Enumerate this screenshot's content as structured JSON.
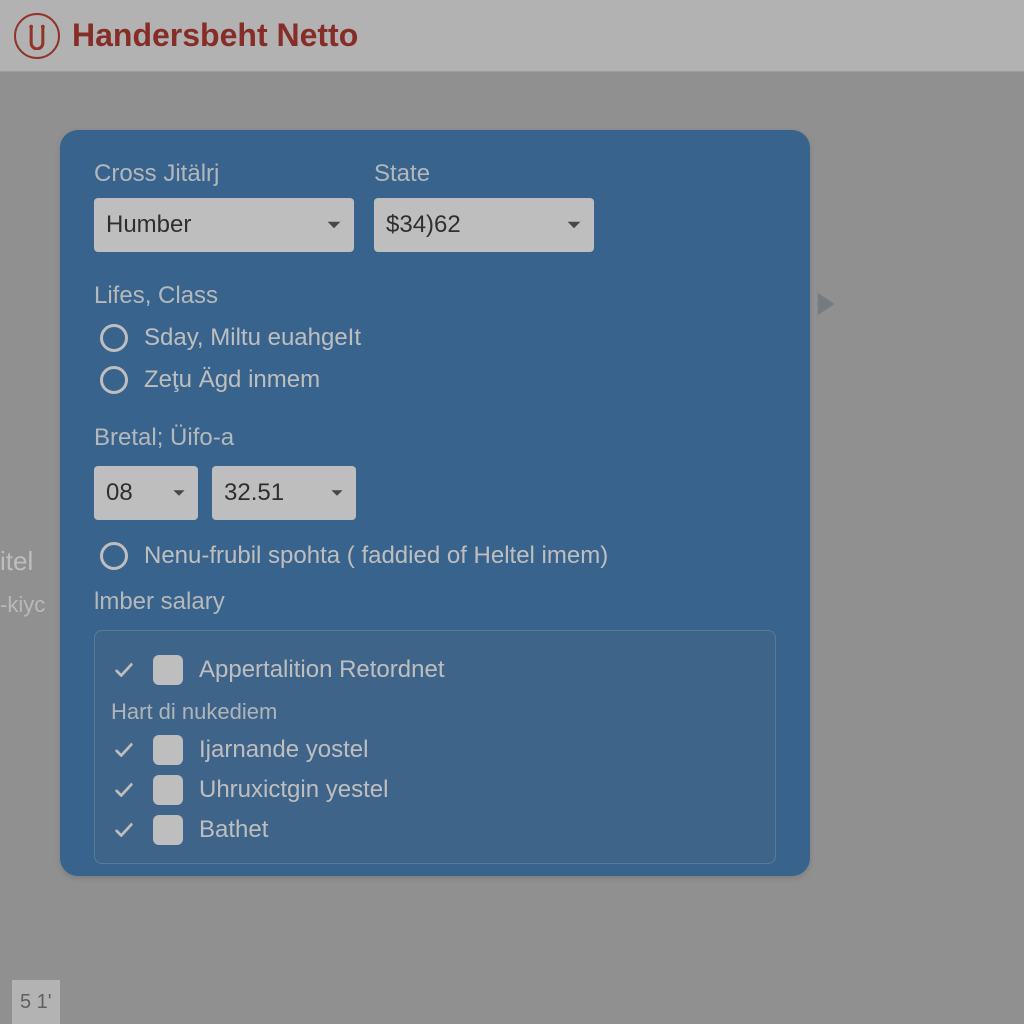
{
  "header": {
    "title": "Handersbeht Netto"
  },
  "background": {
    "line1": "itel",
    "line2": "-kiyc"
  },
  "footer": {
    "frag": "5 1'"
  },
  "card": {
    "field_cross": {
      "label": "Cross Jitälrj",
      "value": "Humber"
    },
    "field_state": {
      "label": "State",
      "value": "$34)62"
    },
    "lifes_class": {
      "title": "Lifes, Class",
      "opt1": "Sday, Miltu euahgeIt",
      "opt2": "Zeţu Ägd inmem"
    },
    "bretal": {
      "title": "Bretal; Üifo-a",
      "val1": "08",
      "val2": "32.51",
      "opt3": "Nenu-frubil spohta ( faddied of Heltel imem)"
    },
    "imber": {
      "title": "lmber salary",
      "item1": "Appertalition Retordnet",
      "sub_title": "Hart di nukediem",
      "item2": "Ijarnande yostel",
      "item3": "Uhruxictgin yestel",
      "item4": "Bathet"
    }
  }
}
